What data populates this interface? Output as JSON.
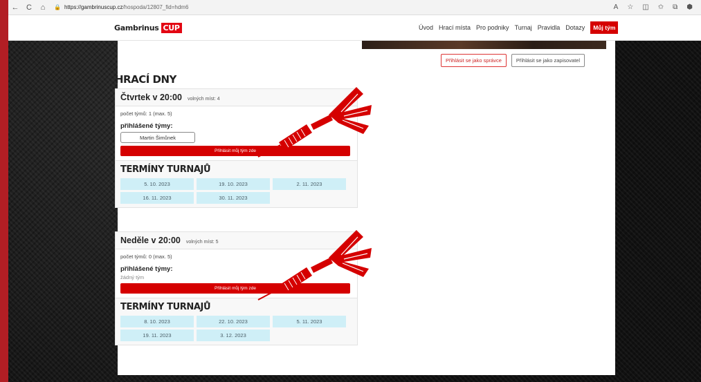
{
  "browser": {
    "url_host": "https://gambrinuscup.cz",
    "url_path": "/hospoda/12807_fid=hdm6",
    "back": "←",
    "reload": "C",
    "home": "⌂"
  },
  "site": {
    "logo_text": "Gambrinus",
    "logo_cup": "CUP",
    "nav": [
      "Úvod",
      "Hrací místa",
      "Pro podniky",
      "Turnaj",
      "Pravidla",
      "Dotazy"
    ],
    "nav_active": "Můj tým"
  },
  "admin": {
    "login_admin": "Přihlásit se jako správce",
    "login_scorer": "Přihlásit se jako zapisovatel"
  },
  "section_title": "HRACÍ DNY",
  "days": [
    {
      "name": "Čtvrtek v 20:00",
      "slots": "volných míst: 4",
      "team_count": "počet týmů: 1 (max. 5)",
      "teams_label": "přihlášené týmy:",
      "teams": [
        "Martin Šimůnek"
      ],
      "signup": "Přihlásit můj tým zde",
      "dates_title": "TERMÍNY TURNAJŮ",
      "dates": [
        "5. 10. 2023",
        "19. 10. 2023",
        "2. 11. 2023",
        "16. 11. 2023",
        "30. 11. 2023"
      ]
    },
    {
      "name": "Neděle v 20:00",
      "slots": "volných míst: 5",
      "team_count": "počet týmů: 0 (max. 5)",
      "teams_label": "přihlášené týmy:",
      "no_team": "žádný tým",
      "signup": "Přihlásit můj tým zde",
      "dates_title": "TERMÍNY TURNAJŮ",
      "dates": [
        "8. 10. 2023",
        "22. 10. 2023",
        "5. 11. 2023",
        "19. 11. 2023",
        "3. 12. 2023"
      ]
    }
  ],
  "colors": {
    "brand_red": "#d50000",
    "date_bg": "#cfeff7"
  }
}
